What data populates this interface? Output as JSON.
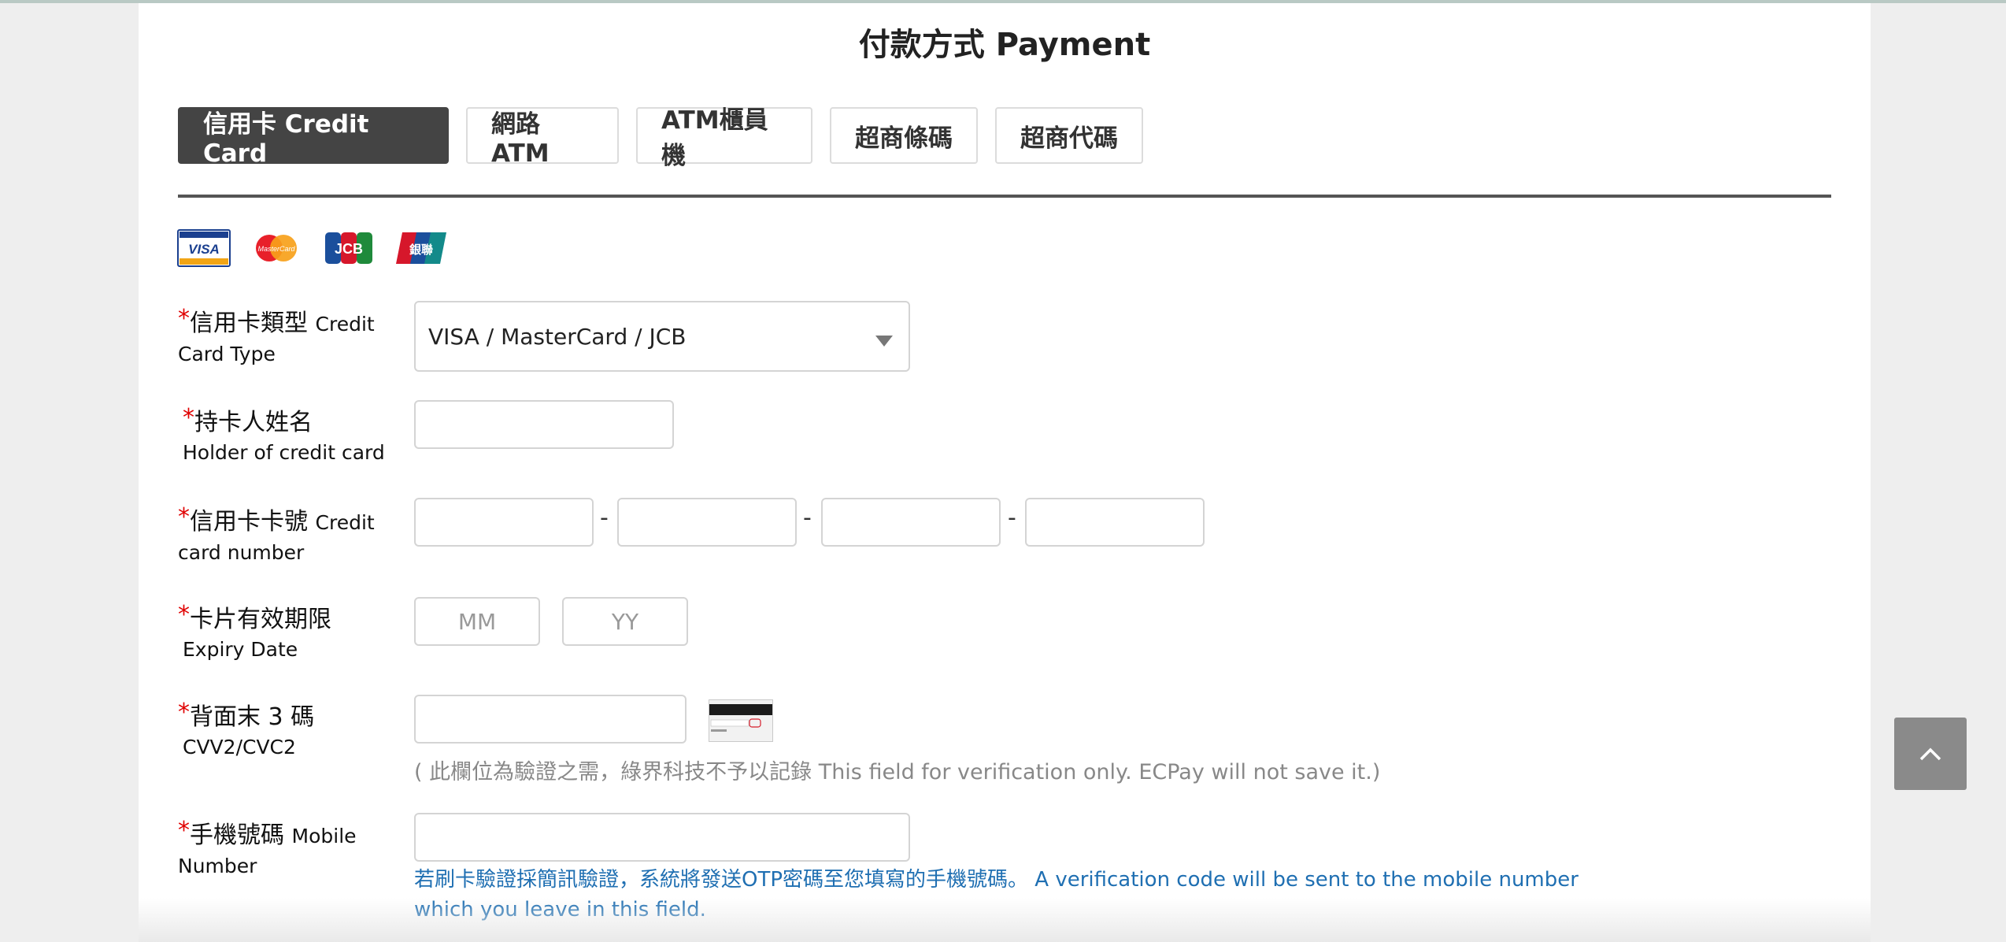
{
  "page": {
    "title": "付款方式 Payment"
  },
  "tabs": [
    {
      "label": "信用卡 Credit Card",
      "active": true
    },
    {
      "label": "網路ATM",
      "active": false
    },
    {
      "label": "ATM櫃員機",
      "active": false
    },
    {
      "label": "超商條碼",
      "active": false
    },
    {
      "label": "超商代碼",
      "active": false
    }
  ],
  "card_logos": [
    {
      "name": "visa",
      "text": "VISA"
    },
    {
      "name": "mastercard",
      "text": "MasterCard"
    },
    {
      "name": "jcb",
      "text": "JCB"
    },
    {
      "name": "unionpay",
      "text": "銀聯"
    }
  ],
  "form": {
    "required_mark": "*",
    "card_type": {
      "label_zh": "信用卡類型",
      "label_en_inline": "Credit",
      "label_en_sub": "Card Type",
      "selected": "VISA / MasterCard / JCB"
    },
    "holder": {
      "label_zh": "持卡人姓名",
      "label_en_sub": "Holder of credit card",
      "value": ""
    },
    "card_number": {
      "label_zh": "信用卡卡號",
      "label_en_inline": "Credit",
      "label_en_sub": "card number",
      "separator": "-",
      "segments": [
        "",
        "",
        "",
        ""
      ]
    },
    "expiry": {
      "label_zh": "卡片有效期限",
      "label_en_sub": "Expiry Date",
      "month_placeholder": "MM",
      "year_placeholder": "YY"
    },
    "cvv": {
      "label_zh": "背面末 3 碼",
      "label_en_sub": "CVV2/CVC2",
      "value": "",
      "hint": "( 此欄位為驗證之需，綠界科技不予以記錄 This field for verification only. ECPay will not save it.)"
    },
    "mobile": {
      "label_zh": "手機號碼",
      "label_en_inline": "Mobile",
      "label_en_sub": "Number",
      "value": "",
      "hint": "若刷卡驗證採簡訊驗證，系統將發送OTP密碼至您填寫的手機號碼。 A verification code will be sent to the mobile number which you leave in this field."
    }
  },
  "colors": {
    "tab_active_bg": "#444444",
    "required": "#e00000",
    "hint_blue": "#1f6fb2",
    "to_top_bg": "#8a8a8a"
  },
  "icons": {
    "to_top": "chevron-up-icon"
  }
}
